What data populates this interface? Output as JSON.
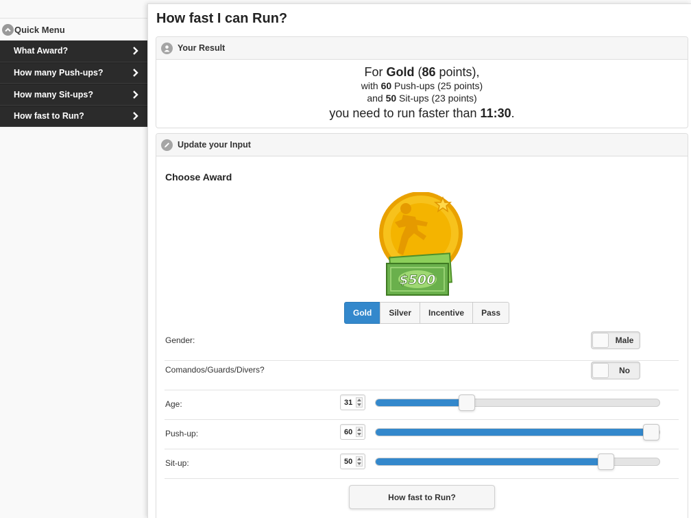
{
  "sidebar": {
    "header": "Quick Menu",
    "items": [
      {
        "label": "What Award?"
      },
      {
        "label": "How many Push-ups?"
      },
      {
        "label": "How many Sit-ups?"
      },
      {
        "label": "How fast to Run?"
      }
    ]
  },
  "page": {
    "title": "How fast I can Run?"
  },
  "result": {
    "header": "Your Result",
    "line1": {
      "prefix": "For ",
      "award": "Gold",
      "open": " (",
      "points": "86",
      "suffix": " points),"
    },
    "line2": {
      "prefix": "with ",
      "count": "60",
      "suffix": " Push-ups (25 points)"
    },
    "line3": {
      "prefix": "and ",
      "count": "50",
      "suffix": " Sit-ups (23 points)"
    },
    "line4": {
      "prefix": "you need to run faster than ",
      "time": "11:30",
      "suffix": "."
    }
  },
  "input": {
    "header": "Update your Input",
    "choose_award": "Choose Award",
    "award_image_text": "$500",
    "award_options": [
      "Gold",
      "Silver",
      "Incentive",
      "Pass"
    ],
    "selected_award": "Gold",
    "gender": {
      "label": "Gender:",
      "value": "Male"
    },
    "vocation": {
      "label": "Comandos/Guards/Divers?",
      "value": "No"
    },
    "age": {
      "label": "Age:",
      "value": "31",
      "level": 0.31
    },
    "pushup": {
      "label": "Push-up:",
      "value": "60",
      "level": 1.0
    },
    "situp": {
      "label": "Sit-up:",
      "value": "50",
      "level": 0.83
    },
    "run_button": "How fast to Run?"
  },
  "colors": {
    "accent": "#3388cc",
    "menu_bg": "#2b2b2b",
    "medal": "#f5b800",
    "cash": "#6ab04c"
  }
}
